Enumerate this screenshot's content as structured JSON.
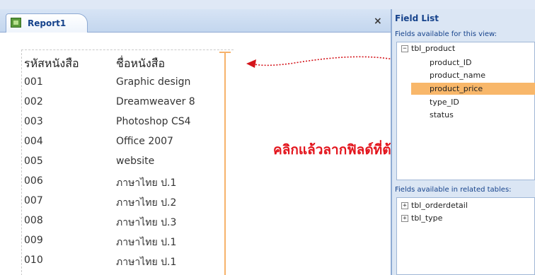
{
  "tab": {
    "label": "Report1"
  },
  "close_glyph": "×",
  "report": {
    "header": {
      "code": "รหัสหนังสือ",
      "name": "ชื่อหนังสือ"
    },
    "rows": [
      {
        "code": "001",
        "name": "Graphic design"
      },
      {
        "code": "002",
        "name": "Dreamweaver 8"
      },
      {
        "code": "003",
        "name": "Photoshop CS4"
      },
      {
        "code": "004",
        "name": "Office 2007"
      },
      {
        "code": "005",
        "name": "website"
      },
      {
        "code": "006",
        "name": "ภาษาไทย ป.1"
      },
      {
        "code": "007",
        "name": "ภาษาไทย ป.2"
      },
      {
        "code": "008",
        "name": "ภาษาไทย ป.3"
      },
      {
        "code": "009",
        "name": "ภาษาไทย ป.1"
      },
      {
        "code": "010",
        "name": "ภาษาไทย ป.1"
      }
    ]
  },
  "annotation": "คลิกแล้วลากฟิลด์ที่ต้องการ",
  "field_list": {
    "title": "Field List",
    "available_label": "Fields available for this view:",
    "table": {
      "toggle": "−",
      "name": "tbl_product"
    },
    "fields": [
      "product_ID",
      "product_name",
      "product_price",
      "type_ID",
      "status"
    ],
    "selected_field": "product_price",
    "related_label": "Fields available in related tables:",
    "related_tables": [
      {
        "toggle": "+",
        "name": "tbl_orderdetail"
      },
      {
        "toggle": "+",
        "name": "tbl_type"
      }
    ]
  },
  "colors": {
    "accent": "#15428b",
    "highlight": "#f8b76a",
    "annotation": "#e3141c",
    "guide": "#f6b26b"
  }
}
